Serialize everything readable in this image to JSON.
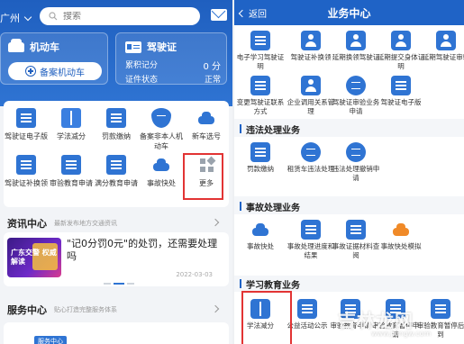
{
  "left": {
    "city": "广州",
    "search_placeholder": "搜索",
    "motor_vehicle": {
      "title": "机动车",
      "add_button": "备案机动车"
    },
    "license": {
      "title": "驾驶证",
      "points_label": "累积记分",
      "points_value": "0 分",
      "status_label": "证件状态",
      "status_value": "正常"
    },
    "services": [
      "驾驶证电子版",
      "学法减分",
      "罚款缴纳",
      "备案非本人机动车",
      "新车选号",
      "驾驶证补换领",
      "审验教育申请",
      "满分教育申请",
      "事故快处",
      "更多"
    ],
    "news": {
      "section_title": "资讯中心",
      "section_sub": "最新发布地方交通资讯",
      "thumb_text": "广东交警\n权威解读",
      "headline": "\"记0分罚0元\"的处罚，还需要处理吗",
      "date": "2022-03-03"
    },
    "service_center": {
      "section_title": "服务中心",
      "section_sub": "贴心打造完整服务体系",
      "banner": "服务中心"
    }
  },
  "right": {
    "back_label": "返回",
    "title": "业务中心",
    "top_items": [
      "电子学习驾驶证明",
      "驾驶证补换领",
      "延期换领驾驶证",
      "延期提交身体证明",
      "延期驾驶证审验"
    ],
    "mid_items": [
      "变更驾驶证联系方式",
      "企业调用关系管理",
      "驾驶证审验业务申请",
      "驾驶证电子版"
    ],
    "sections": [
      {
        "title": "违法处理业务",
        "items": [
          "罚款缴纳",
          "租赁车违法处理",
          "违法处理撤销申请"
        ]
      },
      {
        "title": "事故处理业务",
        "items": [
          "事故快处",
          "事故处理进度和结果",
          "事故证据材料查阅",
          "事故快处模拟"
        ]
      },
      {
        "title": "学习教育业务",
        "items": [
          "学法减分",
          "公益活动公示",
          "审验教育申请",
          "审验教育暂停申请",
          "审验教育暂停后到"
        ]
      }
    ]
  },
  "watermark": {
    "main": "吉林龙网",
    "sub": "www.jlongw.com"
  },
  "colors": {
    "brand_blue": "#1f63c6",
    "highlight_red": "#e23434",
    "orange": "#f08a28"
  }
}
